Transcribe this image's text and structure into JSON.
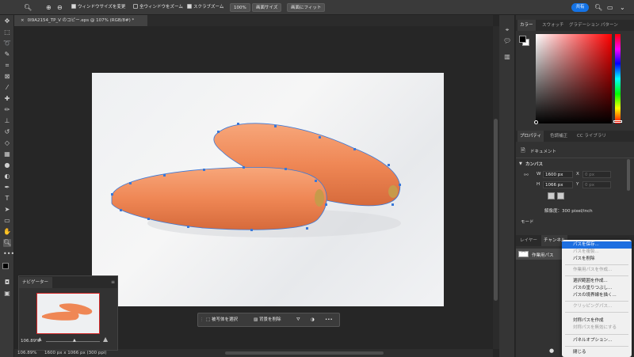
{
  "options_bar": {
    "resize_windows": "ウィンドウサイズを変更",
    "zoom_all": "全ウィンドウをズーム",
    "scrubby_zoom": "スクラブズーム",
    "zoom_value": "100%",
    "fit_screen": "画面サイズ",
    "fill_screen": "画面にフィット",
    "share": "共有"
  },
  "document": {
    "tab_title": "0I9A2154_TP_V のコピー.eps @ 107% (RGB/8#) *",
    "tab_close": "×"
  },
  "context_bar": {
    "select_subject": "被写体を選択",
    "remove_background": "背景を削除",
    "more": "•••"
  },
  "status_bar": {
    "zoom": "106.89%",
    "doc_size": "1600 px x 1066 px (300 ppi)"
  },
  "navigator": {
    "tab": "ナビゲーター",
    "zoom": "106.89%"
  },
  "color_panel": {
    "tabs": [
      "カラー",
      "スウォッチ",
      "グラデーション",
      "パターン"
    ]
  },
  "properties_panel": {
    "tabs": [
      "プロパティ",
      "色調補正",
      "CC ライブラリ"
    ],
    "doc_label": "ドキュメント",
    "canvas_section": "カンバス",
    "w_label": "W",
    "w_value": "1600 px",
    "x_label": "X",
    "x_placeholder": "0 px",
    "h_label": "H",
    "h_value": "1066 px",
    "y_label": "Y",
    "y_placeholder": "0 px",
    "resolution": "解像度：300 pixel/inch",
    "mode": "モード"
  },
  "layers_panel": {
    "tabs": [
      "レイヤー",
      "チャンネル"
    ],
    "path_name": "作業用パス"
  },
  "context_menu": {
    "items": [
      {
        "label": "パスを保存...",
        "state": "highlighted"
      },
      {
        "label": "パスを複製...",
        "state": "disabled"
      },
      {
        "label": "パスを削除",
        "state": "normal"
      },
      {
        "label": "作業用パスを作成...",
        "state": "disabled"
      },
      {
        "label": "選択範囲を作成...",
        "state": "normal"
      },
      {
        "label": "パスの塗りつぶし...",
        "state": "normal"
      },
      {
        "label": "パスの境界線を描く...",
        "state": "normal"
      },
      {
        "label": "クリッピングパス...",
        "state": "disabled"
      },
      {
        "label": "対称パスを作成",
        "state": "normal"
      },
      {
        "label": "対称パスを無効にする",
        "state": "disabled"
      },
      {
        "label": "パネルオプション...",
        "state": "normal"
      },
      {
        "label": "閉じる",
        "state": "normal"
      }
    ]
  },
  "colors": {
    "accent": "#1473e6",
    "path_stroke": "#3a78d8",
    "carrot": "#f08a5a"
  }
}
